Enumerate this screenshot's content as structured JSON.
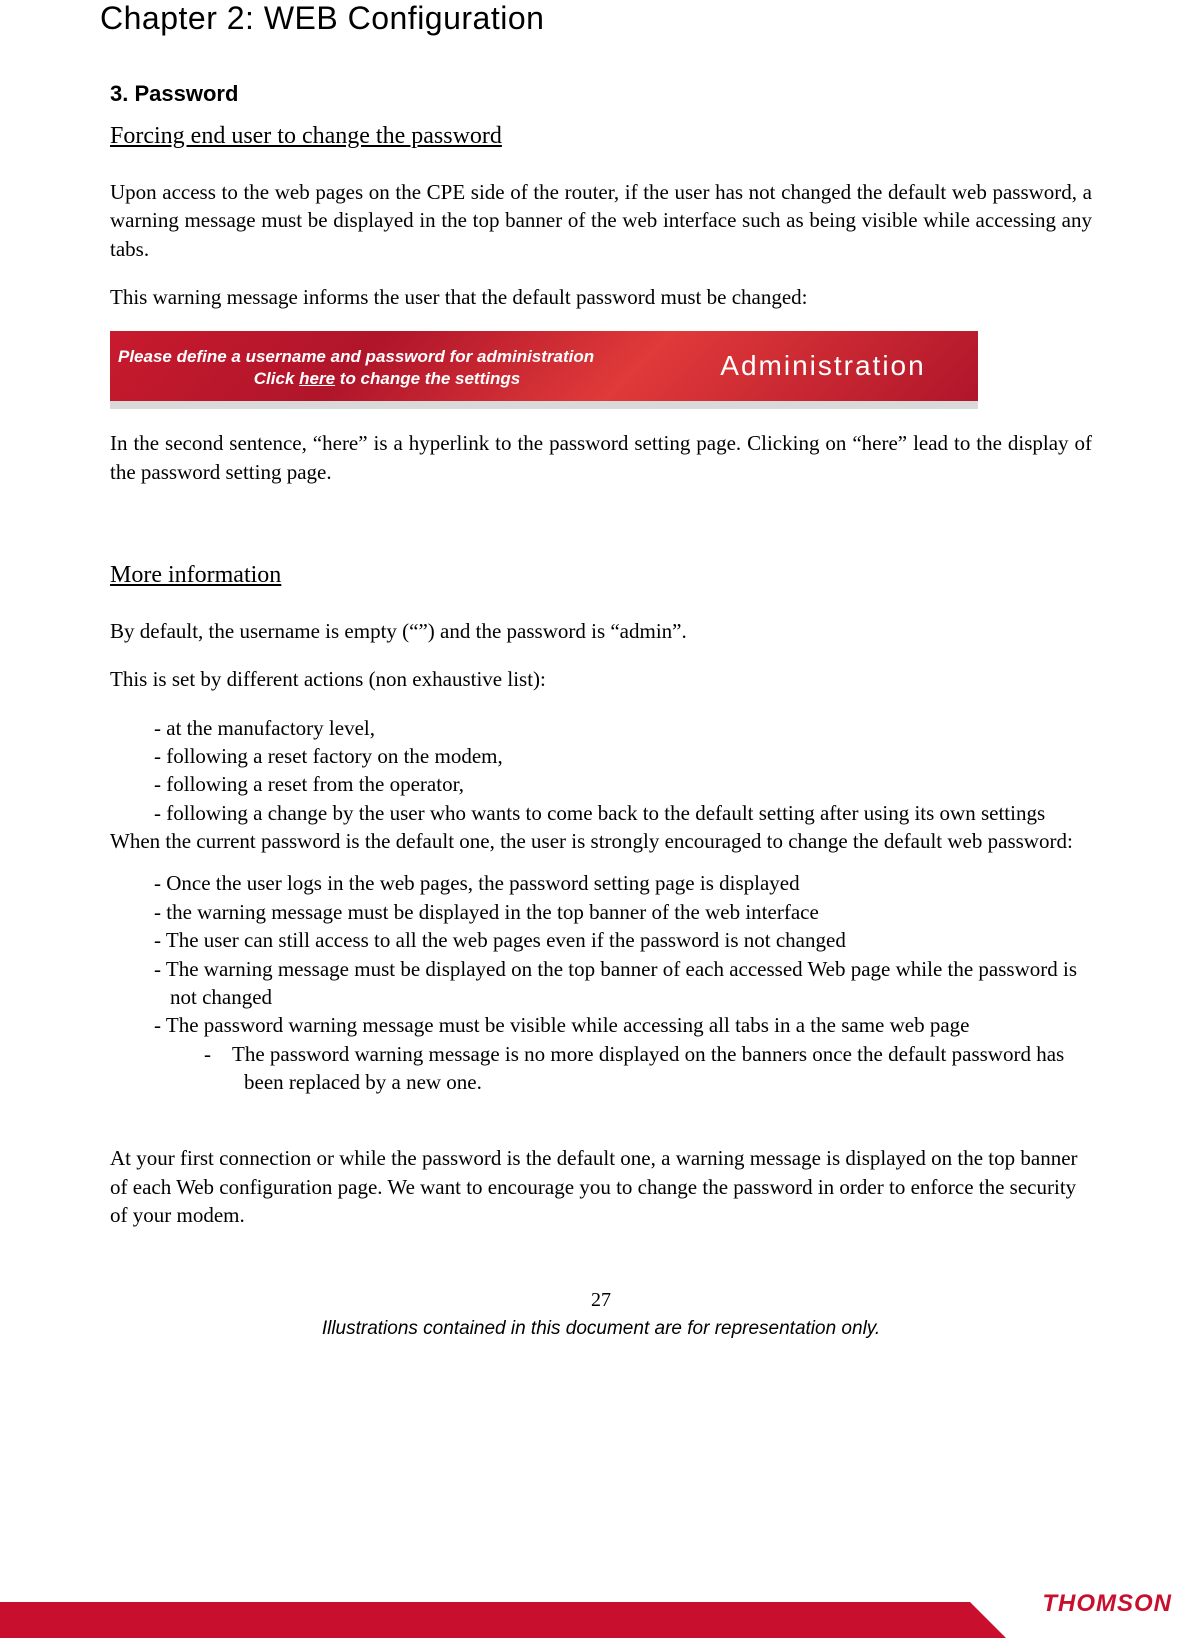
{
  "chapter_title": "Chapter 2: WEB Configuration",
  "section_title": "3. Password",
  "sub1": "Forcing end user to change the password",
  "p1": "Upon access to the web pages on the CPE side of the router, if the user has not changed the default web password, a warning message must be displayed in the top banner of the web interface such as being visible while accessing any tabs.",
  "p2": "This warning message informs the user that the default password must be changed:",
  "banner": {
    "line1": "Please define a username and password for administration",
    "line2_pre": "Click ",
    "line2_link": "here",
    "line2_post": " to change the settings",
    "right": "Administration"
  },
  "p3": "In the second sentence, “here” is a hyperlink to the password setting page. Clicking on “here” lead to the display of the password setting page.",
  "sub2": "More information",
  "p4": "By default, the username is empty (“”) and the password is “admin”.",
  "p5": "This is set by different actions (non exhaustive list):",
  "list1": [
    "at the manufactory level,",
    "following a reset factory on the modem,",
    "following a reset from the operator,",
    "following a change by the user who wants to come back to the default setting after using its own settings"
  ],
  "p6": "When the current password is the default one, the user is strongly encouraged to change the default web password:",
  "list2": [
    "Once the user logs in the web pages, the password setting page is displayed",
    "the warning message must be displayed in the top banner of the web interface",
    "The user can still access to all the web pages even if the password is not changed",
    "The warning message must be displayed on the top banner of each accessed Web page while the password is not changed",
    "The password warning message must be visible while accessing all tabs in a the same web page"
  ],
  "list2_sub": [
    "The password warning message is no more displayed on the banners once the default password has been replaced by a new one."
  ],
  "p7": "At your first connection or while the password is the default one, a warning message is displayed on the top banner of each Web configuration page. We want to encourage you to change the password in order to enforce the security of your modem.",
  "page_number": "27",
  "caption": "Illustrations contained in this document are for representation only.",
  "footer_logo": "THOMSON"
}
